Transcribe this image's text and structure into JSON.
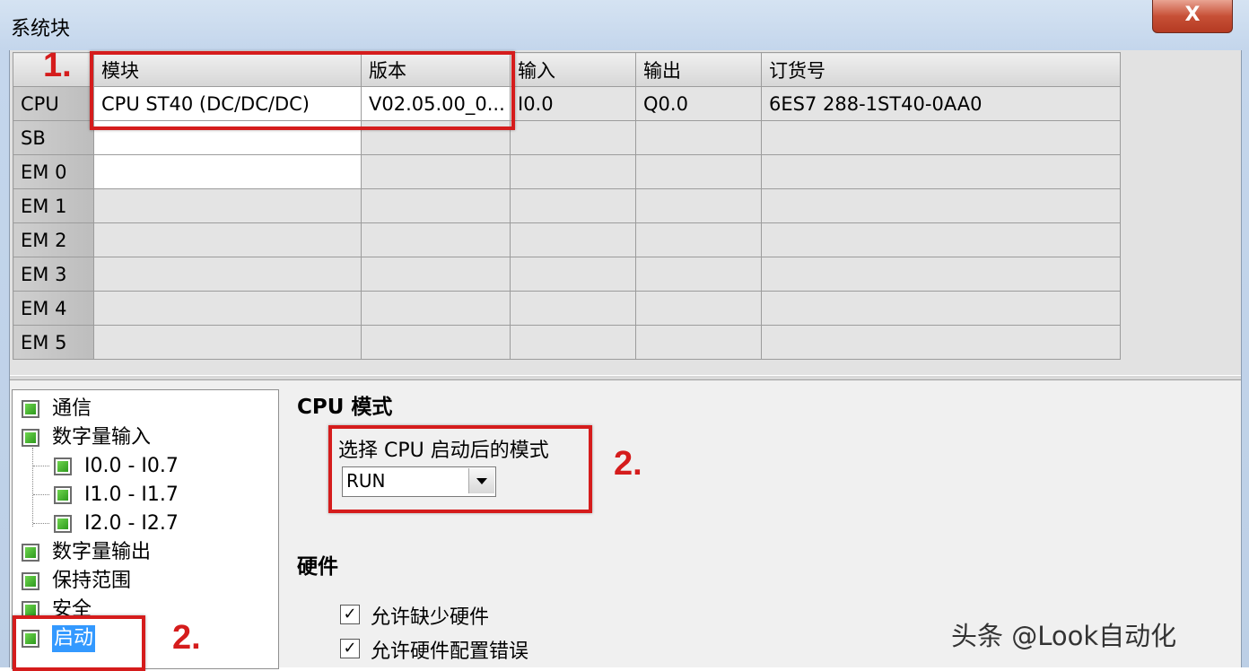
{
  "window": {
    "title": "系统块",
    "close_label": "X"
  },
  "table": {
    "headers": [
      "",
      "模块",
      "版本",
      "输入",
      "输出",
      "订货号"
    ],
    "rows": [
      {
        "slot": "CPU",
        "module": "CPU ST40 (DC/DC/DC)",
        "version": "V02.05.00_0...",
        "input": "I0.0",
        "output": "Q0.0",
        "order": "6ES7 288-1ST40-0AA0"
      },
      {
        "slot": "SB",
        "module": "",
        "version": "",
        "input": "",
        "output": "",
        "order": ""
      },
      {
        "slot": "EM 0",
        "module": "",
        "version": "",
        "input": "",
        "output": "",
        "order": ""
      },
      {
        "slot": "EM 1",
        "module": "",
        "version": "",
        "input": "",
        "output": "",
        "order": ""
      },
      {
        "slot": "EM 2",
        "module": "",
        "version": "",
        "input": "",
        "output": "",
        "order": ""
      },
      {
        "slot": "EM 3",
        "module": "",
        "version": "",
        "input": "",
        "output": "",
        "order": ""
      },
      {
        "slot": "EM 4",
        "module": "",
        "version": "",
        "input": "",
        "output": "",
        "order": ""
      },
      {
        "slot": "EM 5",
        "module": "",
        "version": "",
        "input": "",
        "output": "",
        "order": ""
      }
    ]
  },
  "tree": {
    "items": [
      {
        "label": "通信"
      },
      {
        "label": "数字量输入"
      },
      {
        "label": "I0.0 - I0.7"
      },
      {
        "label": "I1.0 - I1.7"
      },
      {
        "label": "I2.0 - I2.7"
      },
      {
        "label": "数字量输出"
      },
      {
        "label": "保持范围"
      },
      {
        "label": "安全"
      },
      {
        "label": "启动"
      }
    ]
  },
  "cpu_mode": {
    "section_title": "CPU 模式",
    "prompt": "选择 CPU 启动后的模式",
    "selected": "RUN"
  },
  "hardware": {
    "section_title": "硬件",
    "options": [
      {
        "label": "允许缺少硬件",
        "checked": "☑"
      },
      {
        "label": "允许硬件配置错误",
        "checked": "☑"
      }
    ]
  },
  "annotations": {
    "step1": "1.",
    "step2a": "2.",
    "step2b": "2."
  },
  "watermark": "头条 @Look自动化"
}
